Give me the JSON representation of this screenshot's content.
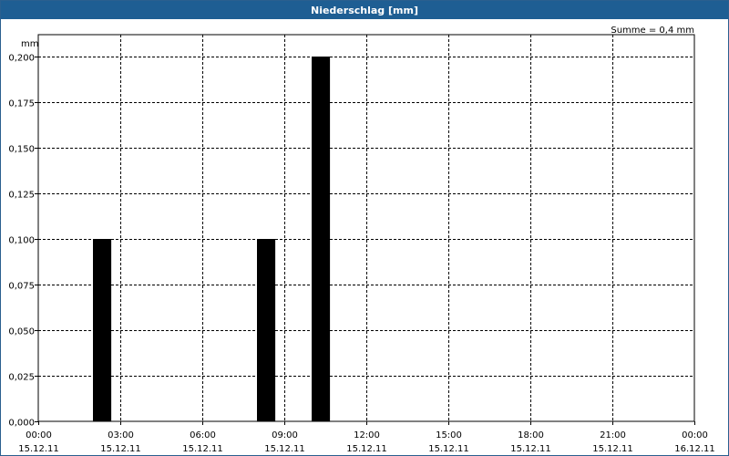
{
  "window": {
    "title": "Niederschlag [mm]"
  },
  "chart_data": {
    "type": "bar",
    "title": "Niederschlag [mm]",
    "ylabel": "mm",
    "sum_label": "Summe = 0,4 mm",
    "ylim": [
      0,
      0.2
    ],
    "yticks": [
      "0,000",
      "0,025",
      "0,050",
      "0,075",
      "0,100",
      "0,125",
      "0,150",
      "0,175",
      "0,200"
    ],
    "xlim_hours": [
      0,
      24
    ],
    "xticks": [
      {
        "hour": 0,
        "time": "00:00",
        "date": "15.12.11"
      },
      {
        "hour": 3,
        "time": "03:00",
        "date": "15.12.11"
      },
      {
        "hour": 6,
        "time": "06:00",
        "date": "15.12.11"
      },
      {
        "hour": 9,
        "time": "09:00",
        "date": "15.12.11"
      },
      {
        "hour": 12,
        "time": "12:00",
        "date": "15.12.11"
      },
      {
        "hour": 15,
        "time": "15:00",
        "date": "15.12.11"
      },
      {
        "hour": 18,
        "time": "18:00",
        "date": "15.12.11"
      },
      {
        "hour": 21,
        "time": "21:00",
        "date": "15.12.11"
      },
      {
        "hour": 24,
        "time": "00:00",
        "date": "16.12.11"
      }
    ],
    "bars": [
      {
        "start_hour": 2.0,
        "end_hour": 2.67,
        "value": 0.1
      },
      {
        "start_hour": 8.0,
        "end_hour": 8.67,
        "value": 0.1
      },
      {
        "start_hour": 10.0,
        "end_hour": 10.67,
        "value": 0.2
      }
    ],
    "grid": true,
    "bar_color": "#000000"
  }
}
